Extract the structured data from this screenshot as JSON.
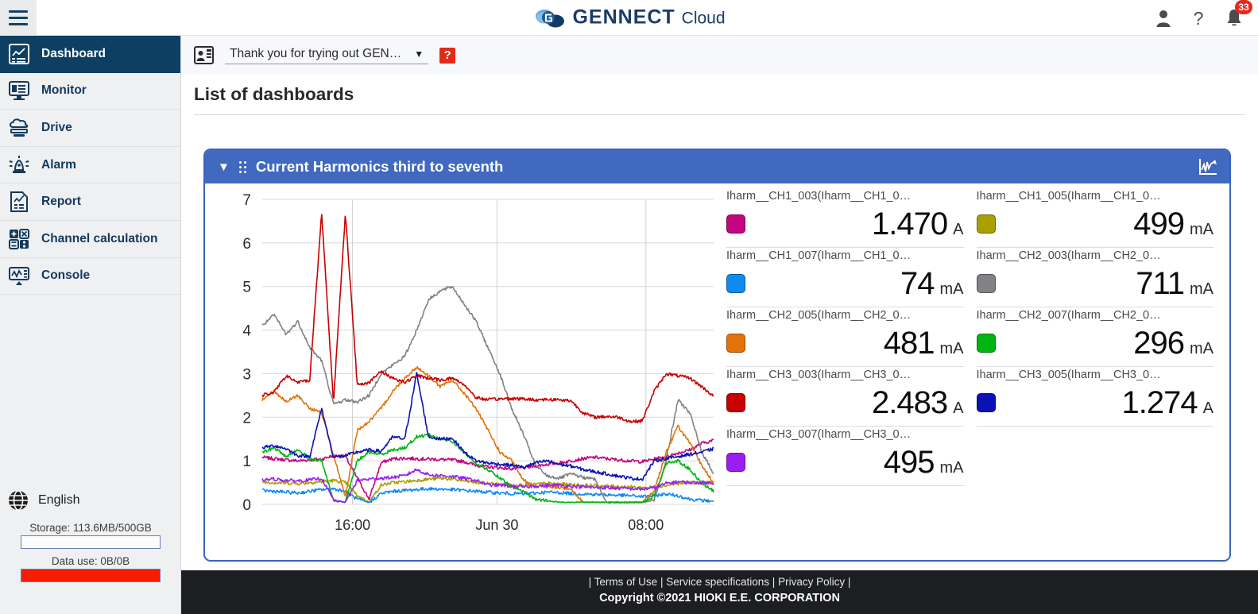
{
  "app": {
    "brand_name": "GENNECT",
    "brand_suffix": "Cloud",
    "hamburger_icon": "hamburger-menu-icon",
    "user_icon": "user-account-icon",
    "help_icon": "question-mark-icon",
    "bell_icon": "notification-bell-icon",
    "notification_count": "33"
  },
  "sidebar": {
    "items": [
      {
        "label": "Dashboard",
        "icon": "dashboard-icon",
        "active": true
      },
      {
        "label": "Monitor",
        "icon": "monitor-screen-icon",
        "active": false
      },
      {
        "label": "Drive",
        "icon": "cloud-drive-icon",
        "active": false
      },
      {
        "label": "Alarm",
        "icon": "alarm-light-icon",
        "active": false
      },
      {
        "label": "Report",
        "icon": "report-document-icon",
        "active": false
      },
      {
        "label": "Channel calculation",
        "icon": "calculator-icon",
        "active": false
      },
      {
        "label": "Console",
        "icon": "console-waveform-icon",
        "active": false
      }
    ],
    "language": {
      "label": "English",
      "icon": "globe-icon"
    },
    "storage": {
      "label": "Storage: 113.6MB/500GB",
      "fill_percent": 0,
      "fill_color": "#f51c00"
    },
    "data_use": {
      "label": "Data use: 0B/0B",
      "fill_percent": 100,
      "fill_color": "#f51c00"
    }
  },
  "subbar": {
    "account_icon": "account-card-icon",
    "selector_value": "Thank you for trying out GEN…",
    "selector_caret": "▼",
    "help_label": "?"
  },
  "page": {
    "title": "List of dashboards"
  },
  "card": {
    "title": "Current Harmonics third to seventh",
    "caret": "▼",
    "grip_icon": "drag-handle-icon",
    "graph_icon": "line-graph-icon",
    "header_color": "#4069bf",
    "border_color": "#3a63bd"
  },
  "chart_data": {
    "type": "line",
    "title": "Current Harmonics third to seventh",
    "xlabel": "",
    "ylabel": "",
    "ylim": [
      0,
      7
    ],
    "yticks": [
      0,
      1,
      2,
      3,
      4,
      5,
      6,
      7
    ],
    "xticks": [
      "16:00",
      "Jun 30",
      "08:00"
    ],
    "xtick_positions": [
      0.2,
      0.52,
      0.85
    ],
    "grid": true,
    "legend_position": "right",
    "series": [
      {
        "name": "Iharm__CH1_003(Iharm__CH1_0…",
        "color": "#c2047f",
        "value": "1.470",
        "unit": "A",
        "y": [
          1.08,
          1.05,
          1.02,
          1.0,
          1.02,
          1.04,
          1.12,
          1.1,
          0.6,
          0.12,
          0.95,
          1.05,
          1.06,
          1.05,
          1.04,
          1.03,
          1.02,
          0.98,
          0.9,
          0.86,
          0.84,
          0.82,
          0.84,
          0.88,
          0.92,
          0.95,
          1.0,
          1.05,
          1.08,
          1.05,
          1.02,
          1.0,
          0.98,
          1.04,
          1.1,
          1.18,
          1.25,
          1.4,
          1.47
        ]
      },
      {
        "name": "Iharm__CH1_005(Iharm__CH1_0…",
        "color": "#a8a000",
        "value": "499",
        "unit": "mA",
        "y": [
          0.52,
          0.5,
          0.49,
          0.48,
          0.5,
          0.52,
          0.55,
          0.5,
          0.2,
          0.05,
          0.44,
          0.5,
          0.52,
          0.55,
          0.58,
          0.6,
          0.58,
          0.54,
          0.5,
          0.48,
          0.46,
          0.45,
          0.44,
          0.46,
          0.48,
          0.47,
          0.45,
          0.44,
          0.43,
          0.42,
          0.41,
          0.4,
          0.38,
          0.4,
          0.44,
          0.48,
          0.5,
          0.5,
          0.499
        ]
      },
      {
        "name": "Iharm__CH1_007(Iharm__CH1_0…",
        "color": "#0d8bf0",
        "value": "74",
        "unit": "mA",
        "y": [
          0.32,
          0.3,
          0.28,
          0.26,
          0.3,
          0.34,
          0.36,
          0.3,
          0.12,
          0.04,
          0.25,
          0.3,
          0.32,
          0.34,
          0.36,
          0.35,
          0.34,
          0.32,
          0.3,
          0.28,
          0.26,
          0.25,
          0.24,
          0.26,
          0.28,
          0.27,
          0.25,
          0.24,
          0.23,
          0.22,
          0.21,
          0.2,
          0.18,
          0.2,
          0.24,
          0.2,
          0.12,
          0.09,
          0.074
        ]
      },
      {
        "name": "Iharm__CH2_003(Iharm__CH2_0…",
        "color": "#808285",
        "value": "711",
        "unit": "mA",
        "y": [
          4.1,
          4.35,
          3.9,
          4.2,
          3.6,
          3.3,
          2.3,
          2.4,
          2.35,
          2.5,
          3.0,
          3.2,
          3.4,
          4.0,
          4.7,
          4.9,
          5.0,
          4.6,
          4.2,
          3.6,
          3.0,
          2.2,
          1.6,
          0.9,
          0.65,
          0.6,
          0.7,
          0.62,
          0.58,
          0.04,
          0.04,
          0.04,
          0.04,
          0.1,
          1.0,
          2.4,
          2.1,
          1.2,
          0.711
        ]
      },
      {
        "name": "Iharm__CH2_005(Iharm__CH2_0…",
        "color": "#e2740a",
        "value": "481",
        "unit": "mA",
        "y": [
          2.4,
          2.6,
          2.35,
          2.5,
          2.2,
          2.1,
          1.15,
          0.15,
          1.7,
          1.9,
          2.2,
          2.6,
          2.9,
          3.15,
          2.95,
          2.7,
          2.85,
          2.55,
          2.2,
          1.7,
          1.2,
          1.0,
          0.55,
          0.42,
          0.4,
          0.38,
          0.36,
          0.05,
          0.05,
          0.05,
          0.05,
          0.05,
          0.05,
          0.3,
          1.2,
          1.8,
          1.4,
          0.9,
          0.481
        ]
      },
      {
        "name": "Iharm__CH2_007(Iharm__CH2_0…",
        "color": "#00b512",
        "value": "296",
        "unit": "mA",
        "y": [
          1.18,
          1.3,
          1.1,
          1.25,
          1.05,
          1.0,
          0.08,
          0.05,
          1.0,
          1.2,
          1.15,
          1.25,
          1.3,
          1.55,
          1.6,
          1.5,
          1.45,
          1.2,
          0.95,
          0.8,
          0.6,
          0.4,
          0.3,
          0.12,
          0.08,
          0.05,
          0.05,
          0.05,
          0.05,
          0.05,
          0.05,
          0.05,
          0.05,
          0.2,
          0.95,
          1.0,
          0.8,
          0.5,
          0.296
        ]
      },
      {
        "name": "Iharm__CH3_003(Iharm__CH3_0…",
        "color": "#c80000",
        "value": "2.483",
        "unit": "A",
        "y": [
          2.5,
          2.58,
          2.95,
          2.8,
          2.85,
          6.7,
          2.35,
          6.7,
          2.75,
          2.8,
          3.05,
          2.9,
          2.8,
          2.95,
          2.9,
          2.85,
          2.9,
          2.75,
          2.45,
          2.4,
          2.42,
          2.43,
          2.42,
          2.4,
          2.41,
          2.4,
          2.38,
          2.1,
          2.0,
          2.02,
          2.0,
          1.9,
          1.92,
          2.6,
          3.0,
          2.95,
          2.9,
          2.7,
          2.483
        ]
      },
      {
        "name": "Iharm__CH3_005(Iharm__CH3_0…",
        "color": "#0b11b5",
        "value": "1.274",
        "unit": "A",
        "y": [
          1.3,
          1.35,
          1.28,
          1.12,
          1.1,
          2.2,
          1.08,
          1.12,
          1.2,
          1.25,
          1.22,
          1.55,
          1.5,
          3.0,
          1.55,
          1.5,
          1.52,
          1.2,
          1.0,
          0.95,
          0.92,
          0.9,
          0.85,
          0.95,
          1.0,
          0.92,
          0.88,
          0.8,
          0.75,
          0.7,
          0.65,
          0.6,
          0.58,
          1.0,
          1.05,
          1.1,
          1.15,
          1.2,
          1.274
        ]
      },
      {
        "name": "Iharm__CH3_007(Iharm__CH3_0…",
        "color": "#9b1ef0",
        "value": "495",
        "unit": "mA",
        "y": [
          0.56,
          0.58,
          0.55,
          0.54,
          0.56,
          0.6,
          0.1,
          0.05,
          0.55,
          0.58,
          0.6,
          0.62,
          0.66,
          0.8,
          0.68,
          0.66,
          0.64,
          0.6,
          0.55,
          0.45,
          0.44,
          0.42,
          0.4,
          0.42,
          0.44,
          0.43,
          0.42,
          0.4,
          0.39,
          0.38,
          0.37,
          0.36,
          0.35,
          0.38,
          0.48,
          0.52,
          0.5,
          0.5,
          0.495
        ]
      }
    ]
  },
  "footer": {
    "links": [
      "Terms of Use",
      "Service specifications",
      "Privacy Policy"
    ],
    "separator": "|",
    "copyright": "Copyright ©2021 HIOKI E.E. CORPORATION"
  }
}
